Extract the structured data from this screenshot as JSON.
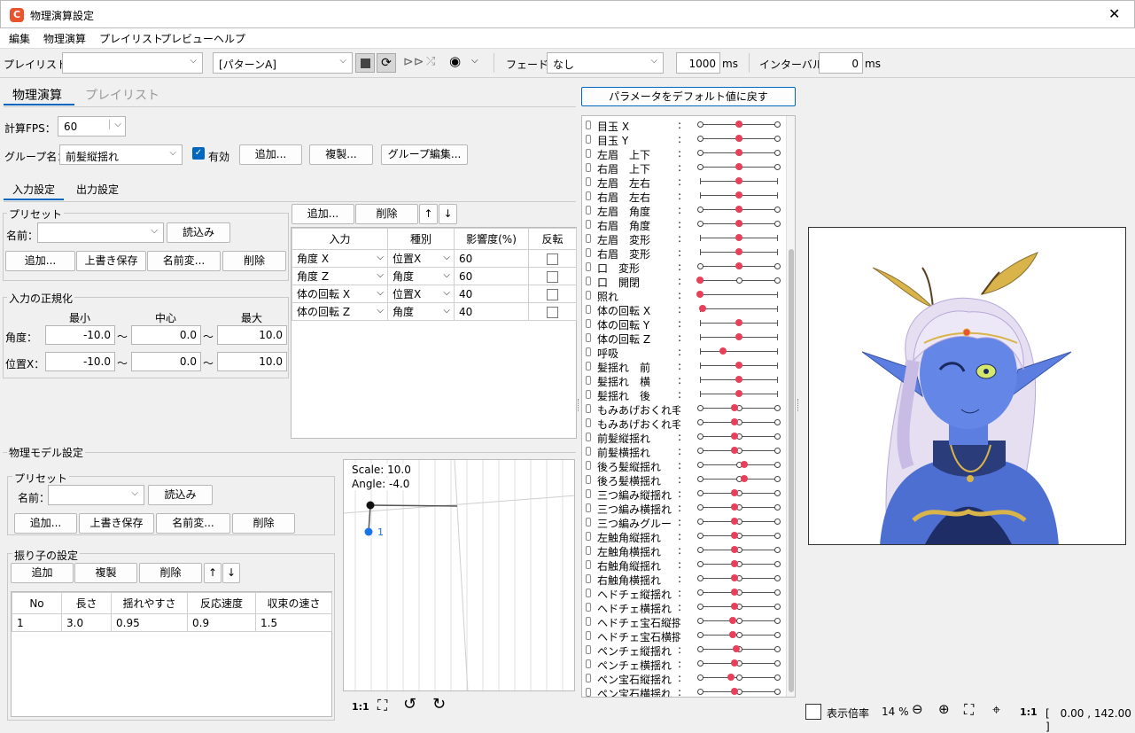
{
  "window": {
    "title": "物理演算設定",
    "close": "✕"
  },
  "menu": [
    "編集",
    "物理演算",
    "プレイリスト",
    "プレビュー",
    "ヘルプ"
  ],
  "toolbar": {
    "playlist_label": "プレイリスト：",
    "playlist_value": "",
    "pattern_value": "[パターンA]",
    "fade_label": "フェード：",
    "fade_value": "なし",
    "duration_value": "1000",
    "ms1": "ms",
    "interval_label": "インターバル：",
    "interval_value": "0",
    "ms2": "ms"
  },
  "tabs": {
    "physics": "物理演算",
    "playlist": "プレイリスト"
  },
  "fps": {
    "label": "計算FPS：",
    "value": "60"
  },
  "group": {
    "label": "グループ名：",
    "value": "前髪縦揺れ",
    "enabled_label": "有効",
    "add": "追加...",
    "duplicate": "複製...",
    "edit": "グループ編集..."
  },
  "subtabs": {
    "input": "入力設定",
    "output": "出力設定"
  },
  "preset": {
    "title": "プリセット",
    "name_label": "名前：",
    "load": "読込み",
    "add": "追加...",
    "overwrite": "上書き保存",
    "rename": "名前変...",
    "delete": "削除"
  },
  "normalize": {
    "title": "入力の正規化",
    "min": "最小",
    "center": "中心",
    "max": "最大",
    "angle_label": "角度：",
    "angle_min": "-10.0",
    "angle_center": "0.0",
    "angle_max": "10.0",
    "pos_label": "位置X：",
    "pos_min": "-10.0",
    "pos_center": "0.0",
    "pos_max": "10.0",
    "tilde": "〜"
  },
  "inputs_toolbar": {
    "add": "追加...",
    "delete": "削除",
    "up": "↑",
    "down": "↓"
  },
  "inputs_table": {
    "headers": [
      "入力",
      "種別",
      "影響度(%)",
      "反転"
    ],
    "rows": [
      {
        "input": "角度 X",
        "type": "位置X",
        "weight": "60"
      },
      {
        "input": "角度 Z",
        "type": "角度",
        "weight": "60"
      },
      {
        "input": "体の回転 X",
        "type": "位置X",
        "weight": "40"
      },
      {
        "input": "体の回転 Z",
        "type": "角度",
        "weight": "40"
      }
    ]
  },
  "model": {
    "title": "物理モデル設定",
    "pendulum_title": "振り子の設定",
    "add": "追加",
    "duplicate": "複製",
    "delete": "削除",
    "headers": [
      "No",
      "長さ",
      "揺れやすさ",
      "反応速度",
      "収束の速さ"
    ],
    "rows": [
      [
        "1",
        "3.0",
        "0.95",
        "0.9",
        "1.5"
      ]
    ]
  },
  "pendulum_view": {
    "scale": "Scale: 10.0",
    "angle": "Angle: -4.0",
    "node_label": "1",
    "ratio": "1:1"
  },
  "reset_button": "パラメータをデフォルト値に戻す",
  "params": [
    {
      "name": "目玉 X",
      "v": 0.5,
      "t": "o"
    },
    {
      "name": "目玉 Y",
      "v": 0.5,
      "t": "o"
    },
    {
      "name": "左眉　上下",
      "v": 0.5,
      "t": "o"
    },
    {
      "name": "右眉　上下",
      "v": 0.5,
      "t": "o"
    },
    {
      "name": "左眉　左右",
      "v": 0.5,
      "t": "t"
    },
    {
      "name": "右眉　左右",
      "v": 0.5,
      "t": "t"
    },
    {
      "name": "左眉　角度",
      "v": 0.5,
      "t": "o"
    },
    {
      "name": "右眉　角度",
      "v": 0.5,
      "t": "o"
    },
    {
      "name": "左眉　変形",
      "v": 0.5,
      "t": "t"
    },
    {
      "name": "右眉　変形",
      "v": 0.5,
      "t": "t"
    },
    {
      "name": "口　変形",
      "v": 0.5,
      "t": "o"
    },
    {
      "name": "口　開閉",
      "v": 0.0,
      "t": "o"
    },
    {
      "name": "照れ",
      "v": 0.0,
      "t": "t"
    },
    {
      "name": "体の回転 X",
      "v": 0.04,
      "t": "t"
    },
    {
      "name": "体の回転 Y",
      "v": 0.5,
      "t": "t"
    },
    {
      "name": "体の回転 Z",
      "v": 0.5,
      "t": "t"
    },
    {
      "name": "呼吸",
      "v": 0.3,
      "t": "t"
    },
    {
      "name": "髪揺れ　前",
      "v": 0.5,
      "t": "t"
    },
    {
      "name": "髪揺れ　横",
      "v": 0.5,
      "t": "t"
    },
    {
      "name": "髪揺れ　後",
      "v": 0.5,
      "t": "t"
    },
    {
      "name": "もみあげおくれ毛...",
      "v": 0.45,
      "t": "o"
    },
    {
      "name": "もみあげおくれ毛...",
      "v": 0.45,
      "t": "o"
    },
    {
      "name": "前髪縦揺れ",
      "v": 0.45,
      "t": "o"
    },
    {
      "name": "前髪横揺れ",
      "v": 0.45,
      "t": "o"
    },
    {
      "name": "後ろ髪縦揺れ",
      "v": 0.58,
      "t": "o"
    },
    {
      "name": "後ろ髪横揺れ",
      "v": 0.58,
      "t": "o"
    },
    {
      "name": "三つ編み縦揺れ",
      "v": 0.45,
      "t": "o"
    },
    {
      "name": "三つ編み横揺れ",
      "v": 0.45,
      "t": "o"
    },
    {
      "name": "三つ編みグルー",
      "v": 0.45,
      "t": "o"
    },
    {
      "name": "左触角縦揺れ",
      "v": 0.45,
      "t": "o"
    },
    {
      "name": "左触角横揺れ",
      "v": 0.45,
      "t": "o"
    },
    {
      "name": "右触角縦揺れ",
      "v": 0.45,
      "t": "o"
    },
    {
      "name": "右触角横揺れ",
      "v": 0.45,
      "t": "o"
    },
    {
      "name": "ヘドチェ縦揺れ",
      "v": 0.45,
      "t": "o"
    },
    {
      "name": "ヘドチェ横揺れ",
      "v": 0.45,
      "t": "o"
    },
    {
      "name": "ヘドチェ宝石縦揺...",
      "v": 0.42,
      "t": "o"
    },
    {
      "name": "ヘドチェ宝石横揺...",
      "v": 0.42,
      "t": "o"
    },
    {
      "name": "ペンチェ縦揺れ",
      "v": 0.47,
      "t": "o"
    },
    {
      "name": "ペンチェ横揺れ",
      "v": 0.45,
      "t": "o"
    },
    {
      "name": "ペン宝石縦揺れ",
      "v": 0.4,
      "t": "o"
    },
    {
      "name": "ペン宝石横揺れ",
      "v": 0.45,
      "t": "o"
    }
  ],
  "status": {
    "label": "表示倍率",
    "zoom": "14 %",
    "ratio": "1:1",
    "coords": "[　0.00 , 142.00 ]"
  },
  "colors": {
    "accent": "#0067c0",
    "dot": "#e8405a"
  }
}
